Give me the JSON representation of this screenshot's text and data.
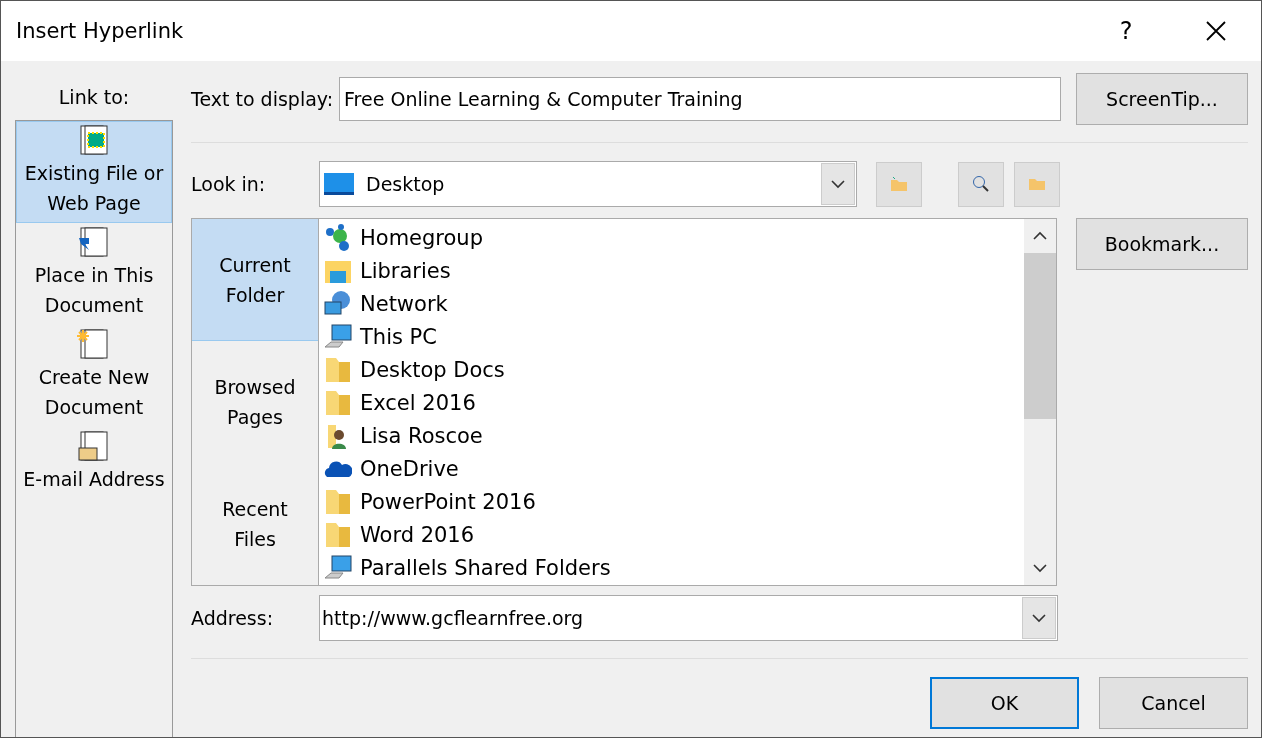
{
  "window": {
    "title": "Insert Hyperlink",
    "help": "?"
  },
  "link_to": {
    "label": "Link to:",
    "items": [
      {
        "kind": "file",
        "label": "Existing File or Web Page",
        "selected": true
      },
      {
        "kind": "place",
        "label": "Place in This Document",
        "selected": false
      },
      {
        "kind": "new",
        "label": "Create New Document",
        "selected": false
      },
      {
        "kind": "email",
        "label": "E-mail Address",
        "selected": false
      }
    ]
  },
  "text_to_display": {
    "label": "Text to display:",
    "value": "Free Online Learning & Computer Training"
  },
  "screentip_button": "ScreenTip...",
  "look_in": {
    "label": "Look in:",
    "value": "Desktop"
  },
  "views": [
    {
      "label": "Current Folder",
      "selected": true
    },
    {
      "label": "Browsed Pages",
      "selected": false
    },
    {
      "label": "Recent Files",
      "selected": false
    }
  ],
  "files": [
    {
      "kind": "homegroup",
      "name": "Homegroup"
    },
    {
      "kind": "libraries",
      "name": "Libraries"
    },
    {
      "kind": "network",
      "name": "Network"
    },
    {
      "kind": "pc",
      "name": "This PC"
    },
    {
      "kind": "folder",
      "name": "Desktop Docs"
    },
    {
      "kind": "folder",
      "name": "Excel 2016"
    },
    {
      "kind": "user",
      "name": "Lisa Roscoe"
    },
    {
      "kind": "cloud",
      "name": "OneDrive"
    },
    {
      "kind": "folder",
      "name": "PowerPoint 2016"
    },
    {
      "kind": "folder",
      "name": "Word 2016"
    },
    {
      "kind": "pc",
      "name": "Parallels Shared Folders"
    }
  ],
  "bookmark_button": "Bookmark...",
  "address": {
    "label": "Address:",
    "value": "http://www.gcflearnfree.org"
  },
  "buttons": [
    {
      "label": "OK",
      "selected": true
    },
    {
      "label": "Cancel",
      "selected": false
    }
  ]
}
